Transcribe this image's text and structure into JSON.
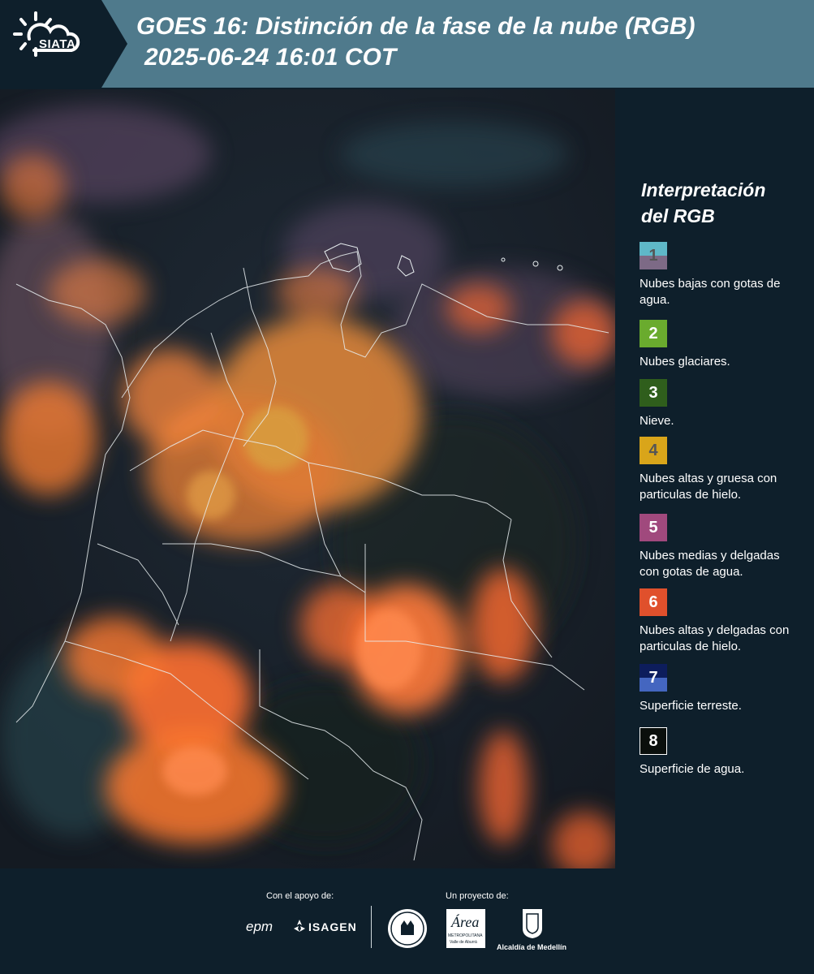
{
  "header": {
    "logo_text": "SIATA",
    "title_line1": "GOES 16: Distinción de la fase de la nube (RGB)",
    "title_line2": "2025-06-24 16:01 COT"
  },
  "legend": {
    "title_line1": "Interpretación",
    "title_line2": "del RGB",
    "items": [
      {
        "num": "1",
        "label": "Nubes bajas con gotas de agua.",
        "color_top": "#5fb8c8",
        "color_bottom": "#7d6a86",
        "text_color": "#555555"
      },
      {
        "num": "2",
        "label": "Nubes glaciares.",
        "color_top": "#6aab2e",
        "color_bottom": "#6aab2e",
        "text_color": "#ffffff"
      },
      {
        "num": "3",
        "label": "Nieve.",
        "color_top": "#2f5e1c",
        "color_bottom": "#2f5e1c",
        "text_color": "#ffffff"
      },
      {
        "num": "4",
        "label": "Nubes altas y gruesa con particulas de hielo.",
        "color_top": "#d9a51a",
        "color_bottom": "#d9a51a",
        "text_color": "#555555"
      },
      {
        "num": "5",
        "label": "Nubes medias y delgadas con gotas de agua.",
        "color_top": "#a0497d",
        "color_bottom": "#a0497d",
        "text_color": "#ffffff"
      },
      {
        "num": "6",
        "label": "Nubes altas y delgadas con particulas de hielo.",
        "color_top": "#e0502c",
        "color_bottom": "#e0502c",
        "text_color": "#ffffff"
      },
      {
        "num": "7",
        "label": "Superficie terreste.",
        "color_top": "#0d1d5c",
        "color_bottom": "#4466c0",
        "text_color": "#ffffff"
      },
      {
        "num": "8",
        "label": "Superficie de agua.",
        "color_top": "#0a0f0c",
        "color_bottom": "#0a0f0c",
        "text_color": "#ffffff"
      }
    ]
  },
  "footer": {
    "support_label": "Con el apoyo de:",
    "project_label": "Un proyecto de:",
    "epm": "epm",
    "isagen": "ISAGEN",
    "area_main": "Área",
    "area_sub": "METROPOLITANA",
    "area_sub2": "Valle de Aburrá",
    "alcaldia": "Alcaldía de Medellín"
  },
  "colors": {
    "header_bg": "#4f7a8c",
    "panel_bg": "#0e1f2b",
    "cloud_orange": "#ff7a2e"
  }
}
